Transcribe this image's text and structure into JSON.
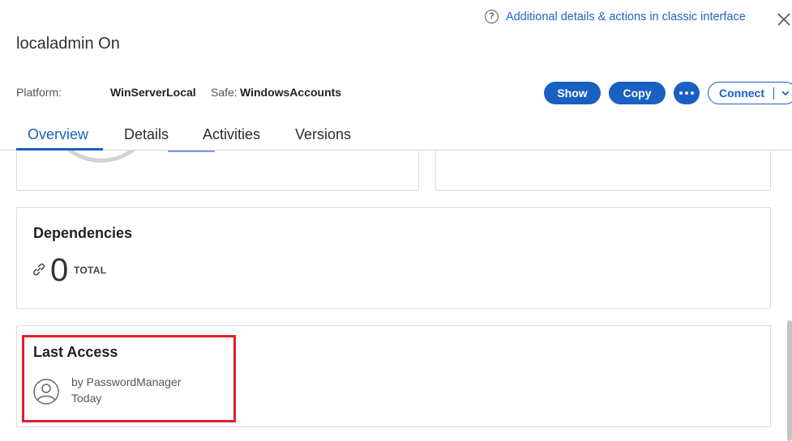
{
  "header": {
    "classic_link": "Additional details & actions in classic interface",
    "account_title": "localadmin On"
  },
  "info": {
    "platform_label": "Platform:",
    "platform_value": "WinServerLocal",
    "safe_label": "Safe:",
    "safe_value": "WindowsAccounts"
  },
  "actions": {
    "show": "Show",
    "copy": "Copy",
    "connect": "Connect"
  },
  "tabs": [
    {
      "label": "Overview",
      "active": true
    },
    {
      "label": "Details",
      "active": false
    },
    {
      "label": "Activities",
      "active": false
    },
    {
      "label": "Versions",
      "active": false
    }
  ],
  "dependencies": {
    "title": "Dependencies",
    "count": "0",
    "total_label": "TOTAL"
  },
  "last_access": {
    "title": "Last Access",
    "by": "by PasswordManager",
    "when": "Today"
  },
  "colors": {
    "accent": "#1a5fc2",
    "highlight": "#e0202a"
  }
}
